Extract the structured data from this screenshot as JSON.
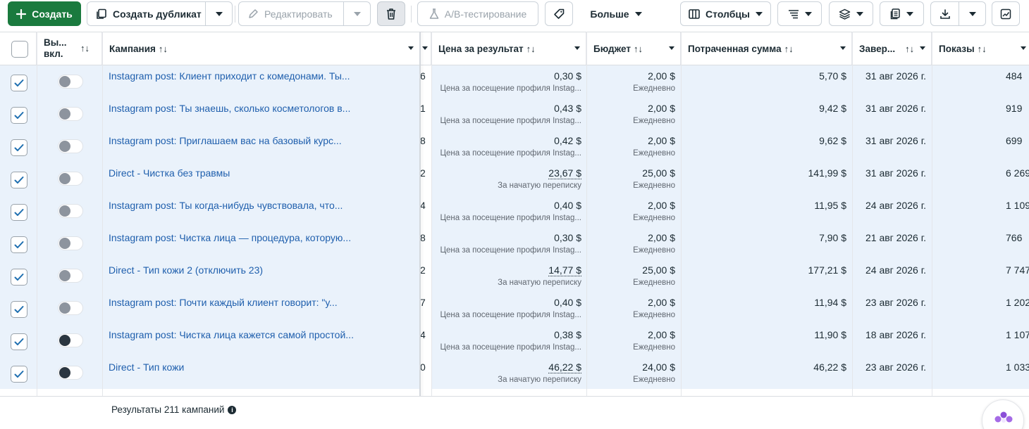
{
  "toolbar": {
    "create_label": "Создать",
    "duplicate_label": "Создать дубликат",
    "edit_label": "Редактировать",
    "ab_test_label": "A/B-тестирование",
    "more_label": "Больше",
    "columns_label": "Столбцы"
  },
  "table": {
    "headers": {
      "toggle": "Вы... вкл.",
      "campaign": "Кампания",
      "cost_per_result": "Цена за результат",
      "budget": "Бюджет",
      "spent": "Потраченная сумма",
      "ends": "Завер...",
      "impressions": "Показы"
    },
    "sort_symbol": "↑↓",
    "rows": [
      {
        "checked": true,
        "toggle_on": false,
        "campaign": "Instagram post: Клиент приходит с комедонами. Ты...",
        "results_trunc": "6",
        "cost": "0,30 $",
        "cost_sub": "Цена за посещение профиля Instag...",
        "budget": "2,00 $",
        "budget_sub": "Ежедневно",
        "spent": "5,70 $",
        "ends": "31 авг 2026 г.",
        "impressions": "484"
      },
      {
        "checked": true,
        "toggle_on": false,
        "campaign": "Instagram post: Ты знаешь, сколько косметологов в...",
        "results_trunc": "1",
        "cost": "0,43 $",
        "cost_sub": "Цена за посещение профиля Instag...",
        "budget": "2,00 $",
        "budget_sub": "Ежедневно",
        "spent": "9,42 $",
        "ends": "31 авг 2026 г.",
        "impressions": "919"
      },
      {
        "checked": true,
        "toggle_on": false,
        "campaign": "Instagram post: Приглашаем вас на базовый курс...",
        "results_trunc": "8",
        "cost": "0,42 $",
        "cost_sub": "Цена за посещение профиля Instag...",
        "budget": "2,00 $",
        "budget_sub": "Ежедневно",
        "spent": "9,62 $",
        "ends": "31 авг 2026 г.",
        "impressions": "699"
      },
      {
        "checked": true,
        "toggle_on": false,
        "campaign": "Direct - Чистка без травмы",
        "results_trunc": "2",
        "cost": "23,67 $",
        "cost_dotted": true,
        "cost_sub": "За начатую переписку",
        "budget": "25,00 $",
        "budget_sub": "Ежедневно",
        "spent": "141,99 $",
        "ends": "31 авг 2026 г.",
        "impressions": "6 269"
      },
      {
        "checked": true,
        "toggle_on": false,
        "campaign": "Instagram post: Ты когда-нибудь чувствовала, что...",
        "results_trunc": "4",
        "cost": "0,40 $",
        "cost_sub": "Цена за посещение профиля Instag...",
        "budget": "2,00 $",
        "budget_sub": "Ежедневно",
        "spent": "11,95 $",
        "ends": "24 авг 2026 г.",
        "impressions": "1 109"
      },
      {
        "checked": true,
        "toggle_on": false,
        "campaign": "Instagram post: Чистка лица — процедура, которую...",
        "results_trunc": "8",
        "cost": "0,30 $",
        "cost_sub": "Цена за посещение профиля Instag...",
        "budget": "2,00 $",
        "budget_sub": "Ежедневно",
        "spent": "7,90 $",
        "ends": "21 авг 2026 г.",
        "impressions": "766"
      },
      {
        "checked": true,
        "toggle_on": false,
        "campaign": "Direct - Тип кожи 2 (отключить 23)",
        "results_trunc": "2",
        "cost": "14,77 $",
        "cost_dotted": true,
        "cost_sub": "За начатую переписку",
        "budget": "25,00 $",
        "budget_sub": "Ежедневно",
        "spent": "177,21 $",
        "ends": "24 авг 2026 г.",
        "impressions": "7 747"
      },
      {
        "checked": true,
        "toggle_on": false,
        "campaign": "Instagram post: Почти каждый клиент говорит: \"у...",
        "results_trunc": "7",
        "cost": "0,40 $",
        "cost_sub": "Цена за посещение профиля Instag...",
        "budget": "2,00 $",
        "budget_sub": "Ежедневно",
        "spent": "11,94 $",
        "ends": "23 авг 2026 г.",
        "impressions": "1 202"
      },
      {
        "checked": true,
        "toggle_on": true,
        "campaign": "Instagram post: Чистка лица кажется самой простой...",
        "results_trunc": "4",
        "cost": "0,38 $",
        "cost_sub": "Цена за посещение профиля Instag...",
        "budget": "2,00 $",
        "budget_sub": "Ежедневно",
        "spent": "11,90 $",
        "ends": "18 авг 2026 г.",
        "impressions": "1 107"
      },
      {
        "checked": true,
        "toggle_on": true,
        "campaign": "Direct - Тип кожи",
        "results_trunc": "0",
        "cost": "46,22 $",
        "cost_dotted": true,
        "cost_sub": "За начатую переписку",
        "budget": "24,00 $",
        "budget_sub": "Ежедневно",
        "spent": "46,22 $",
        "ends": "23 авг 2026 г.",
        "impressions": "1 033"
      }
    ]
  },
  "footer": {
    "results_label": "Результаты 211 кампаний"
  },
  "icons": {
    "create": "plus-icon",
    "duplicate": "duplicate-icon",
    "edit": "pencil-icon",
    "delete": "trash-icon",
    "ab_test": "flask-icon",
    "tag": "tag-icon",
    "columns": "columns-icon",
    "breakdown": "breakdown-icon",
    "layers": "layers-icon",
    "reports": "reports-icon",
    "export": "download-icon",
    "chart": "chart-icon",
    "info": "info-icon",
    "assistant": "assistant-icon"
  },
  "colors": {
    "primary": "#1a7a3e",
    "link": "#1f5fad",
    "row_selected": "#eaf2fb",
    "checkbox_check": "#1f6fb0"
  }
}
